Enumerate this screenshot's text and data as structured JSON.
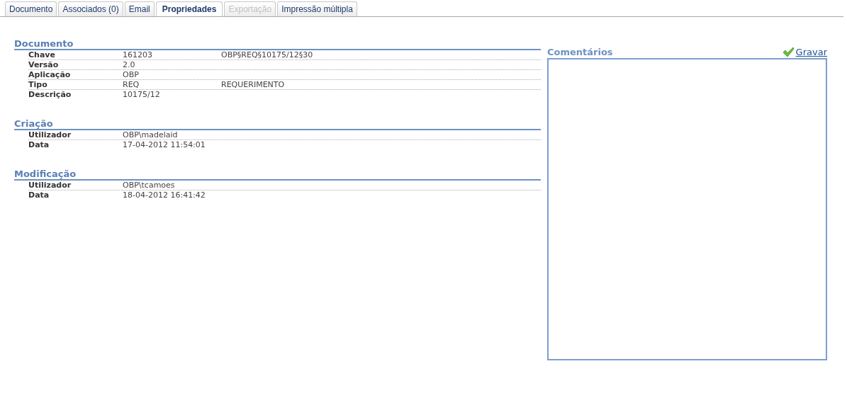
{
  "tabs": [
    {
      "label": "Documento",
      "selected": false,
      "disabled": false
    },
    {
      "label": "Associados (0)",
      "selected": false,
      "disabled": false
    },
    {
      "label": "Email",
      "selected": false,
      "disabled": false
    },
    {
      "label": "Propriedades",
      "selected": true,
      "disabled": false
    },
    {
      "label": "Exportação",
      "selected": false,
      "disabled": true
    },
    {
      "label": "Impressão múltipla",
      "selected": false,
      "disabled": false
    }
  ],
  "sections": [
    {
      "title": "Documento",
      "rows": [
        {
          "label": "Chave",
          "value": "161203",
          "extra": "OBP§REQ§10175/12§30"
        },
        {
          "label": "Versão",
          "value": "2.0"
        },
        {
          "label": "Aplicação",
          "value": "OBP"
        },
        {
          "label": "Tipo",
          "value": "REQ",
          "extra": "REQUERIMENTO"
        },
        {
          "label": "Descrição",
          "value": "10175/12"
        }
      ]
    },
    {
      "title": "Criação",
      "rows": [
        {
          "label": "Utilizador",
          "value": "OBP\\madelaid"
        },
        {
          "label": "Data",
          "value": "17-04-2012 11:54:01"
        }
      ]
    },
    {
      "title": "Modificação",
      "rows": [
        {
          "label": "Utilizador",
          "value": "OBP\\tcamoes"
        },
        {
          "label": "Data",
          "value": "18-04-2012 16:41:42"
        }
      ]
    }
  ],
  "comments": {
    "title": "Comentários",
    "save_link": "Gravar"
  }
}
